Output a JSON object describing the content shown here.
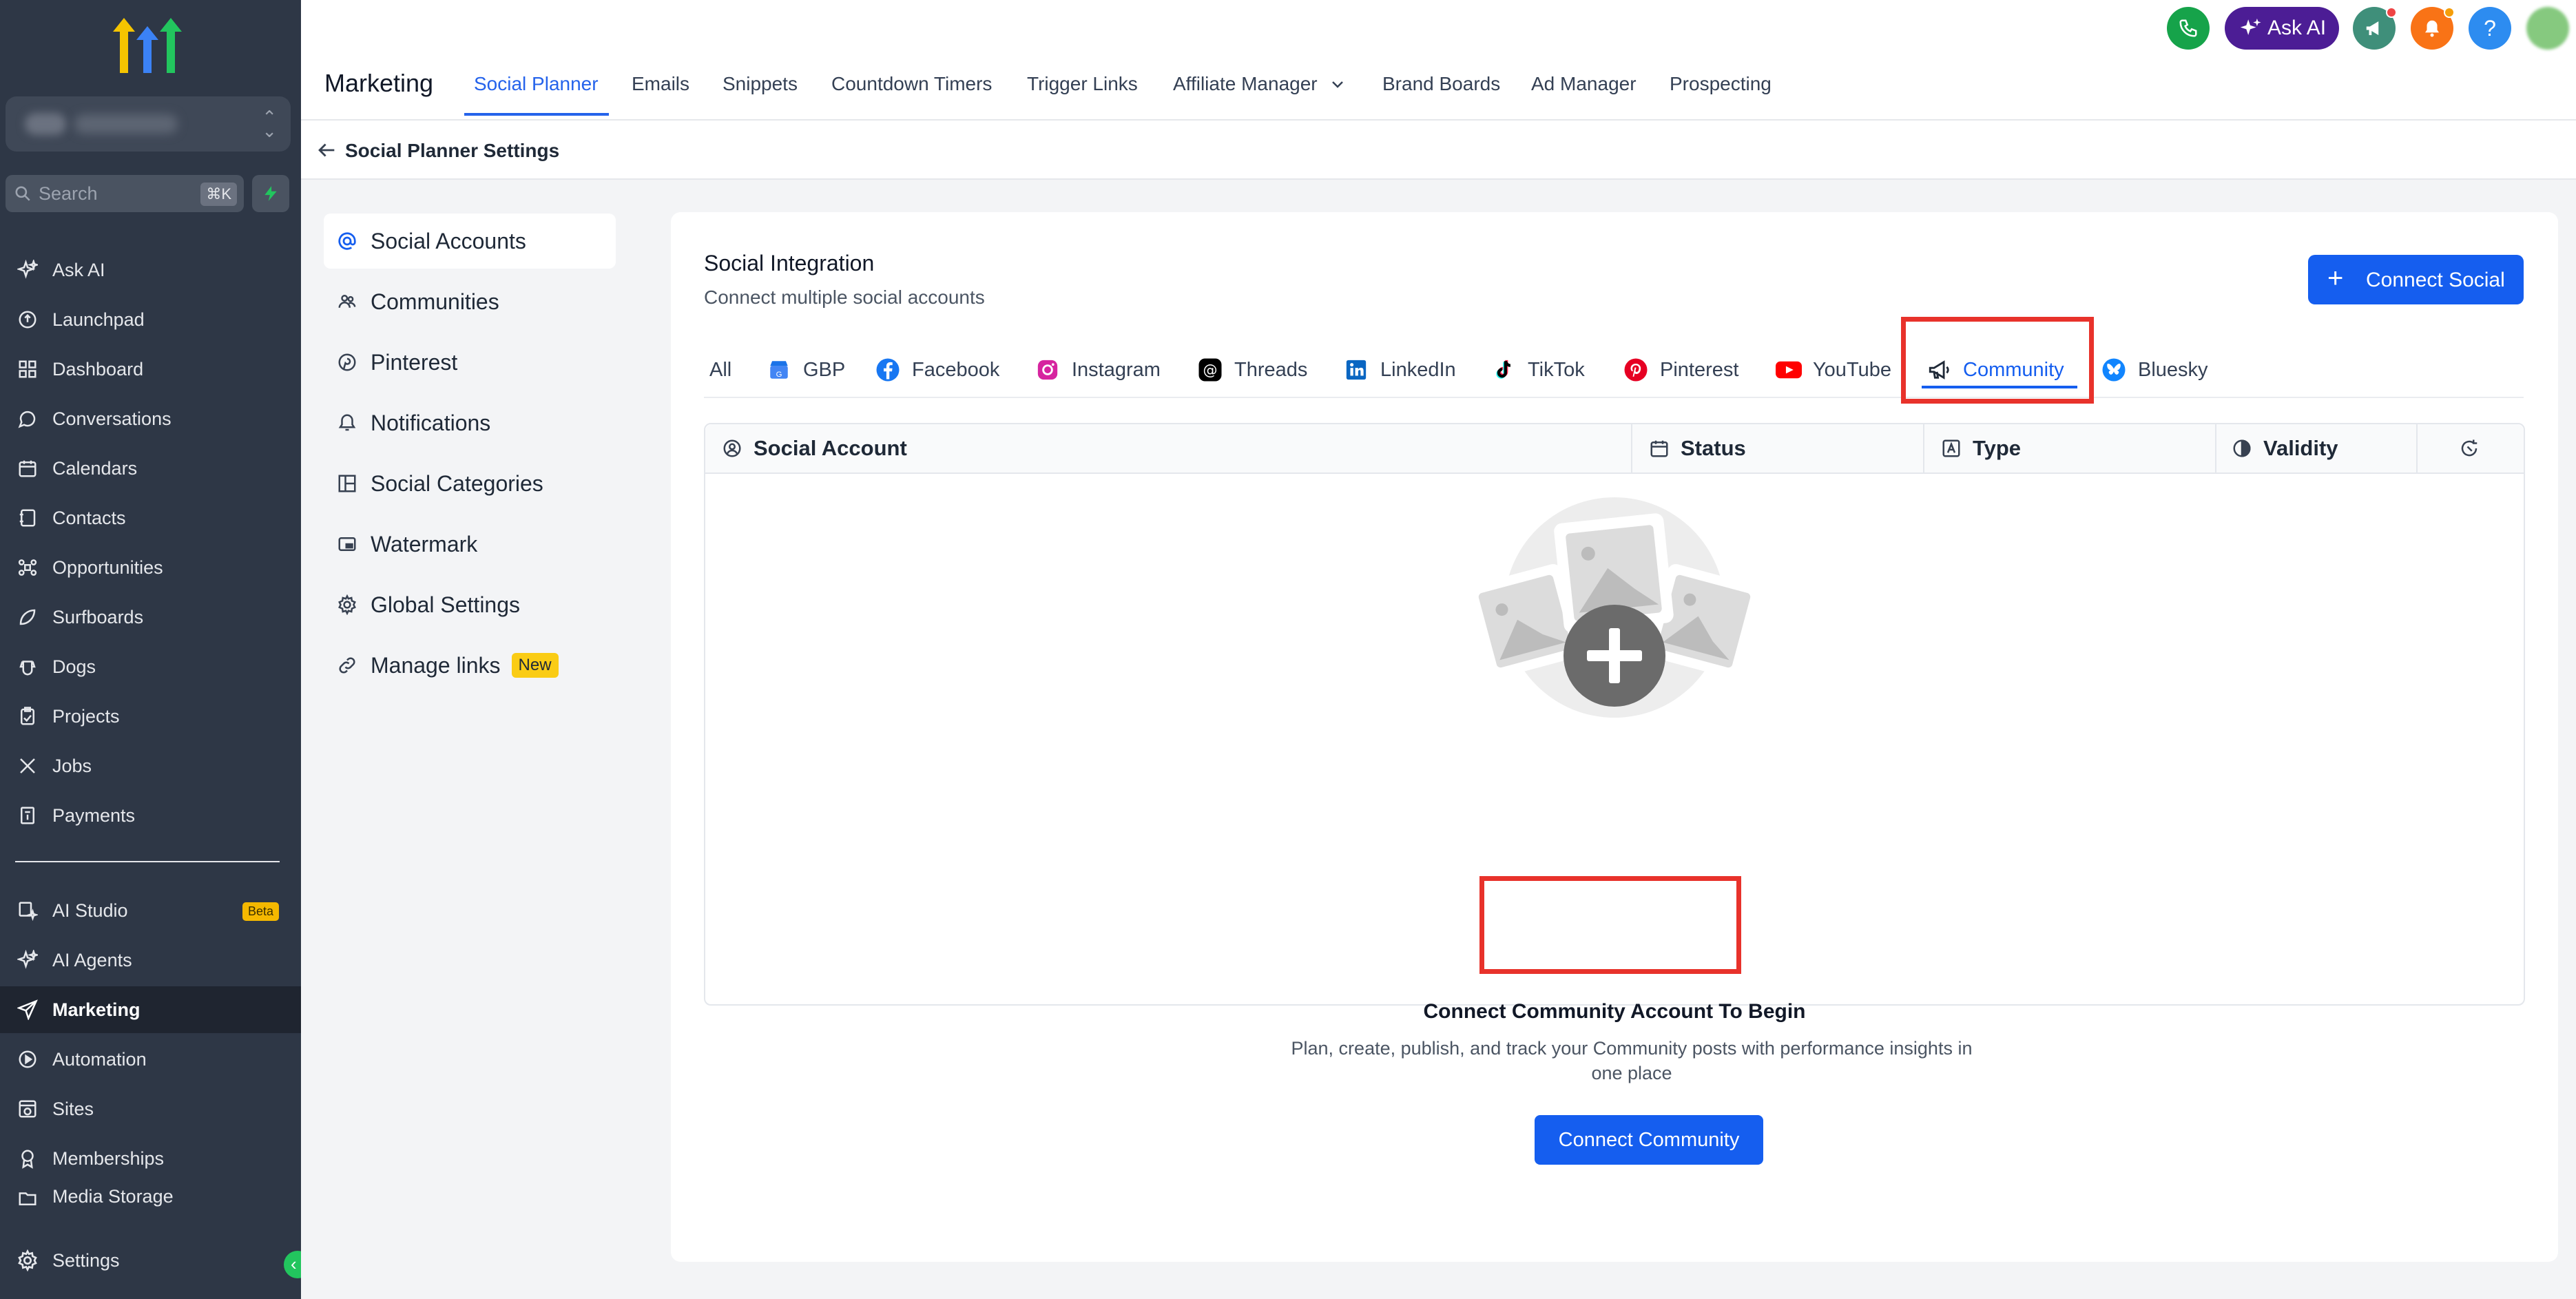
{
  "sidebar": {
    "search_placeholder": "Search",
    "search_shortcut": "⌘K",
    "items": [
      {
        "label": "Ask AI"
      },
      {
        "label": "Launchpad"
      },
      {
        "label": "Dashboard"
      },
      {
        "label": "Conversations"
      },
      {
        "label": "Calendars"
      },
      {
        "label": "Contacts"
      },
      {
        "label": "Opportunities"
      },
      {
        "label": "Surfboards"
      },
      {
        "label": "Dogs"
      },
      {
        "label": "Projects"
      },
      {
        "label": "Jobs"
      },
      {
        "label": "Payments"
      }
    ],
    "items2": [
      {
        "label": "AI Studio",
        "badge": "Beta"
      },
      {
        "label": "AI Agents"
      },
      {
        "label": "Marketing",
        "active": true
      },
      {
        "label": "Automation"
      },
      {
        "label": "Sites"
      },
      {
        "label": "Memberships"
      },
      {
        "label": "Media Storage"
      }
    ],
    "settings_label": "Settings"
  },
  "header": {
    "section_title": "Marketing",
    "tabs": [
      {
        "label": "Social Planner",
        "active": true
      },
      {
        "label": "Emails"
      },
      {
        "label": "Snippets"
      },
      {
        "label": "Countdown Timers"
      },
      {
        "label": "Trigger Links"
      },
      {
        "label": "Affiliate Manager"
      },
      {
        "label": "Brand Boards"
      },
      {
        "label": "Ad Manager"
      },
      {
        "label": "Prospecting"
      }
    ],
    "ask_ai_label": "Ask AI",
    "help_label": "?"
  },
  "breadcrumb": {
    "title": "Social Planner Settings"
  },
  "settings_nav": {
    "items": [
      {
        "label": "Social Accounts",
        "active": true
      },
      {
        "label": "Communities"
      },
      {
        "label": "Pinterest"
      },
      {
        "label": "Notifications"
      },
      {
        "label": "Social Categories"
      },
      {
        "label": "Watermark"
      },
      {
        "label": "Global Settings"
      },
      {
        "label": "Manage links",
        "badge": "New"
      }
    ]
  },
  "integration": {
    "title": "Social Integration",
    "subtitle": "Connect multiple social accounts",
    "connect_social_label": "Connect Social",
    "platform_tabs": [
      {
        "label": "All"
      },
      {
        "label": "GBP"
      },
      {
        "label": "Facebook"
      },
      {
        "label": "Instagram"
      },
      {
        "label": "Threads"
      },
      {
        "label": "LinkedIn"
      },
      {
        "label": "TikTok"
      },
      {
        "label": "Pinterest"
      },
      {
        "label": "YouTube"
      },
      {
        "label": "Community",
        "active": true
      },
      {
        "label": "Bluesky"
      }
    ],
    "table_headers": [
      "Social Account",
      "Status",
      "Type",
      "Validity"
    ],
    "empty_title": "Connect Community Account To Begin",
    "empty_desc": "Plan, create, publish, and track your Community posts with performance insights in one place",
    "connect_community_label": "Connect Community"
  },
  "colors": {
    "primary": "#155eef",
    "sidebar_bg": "#2e3746",
    "highlight": "#e8322b",
    "new_badge": "#facc15"
  }
}
